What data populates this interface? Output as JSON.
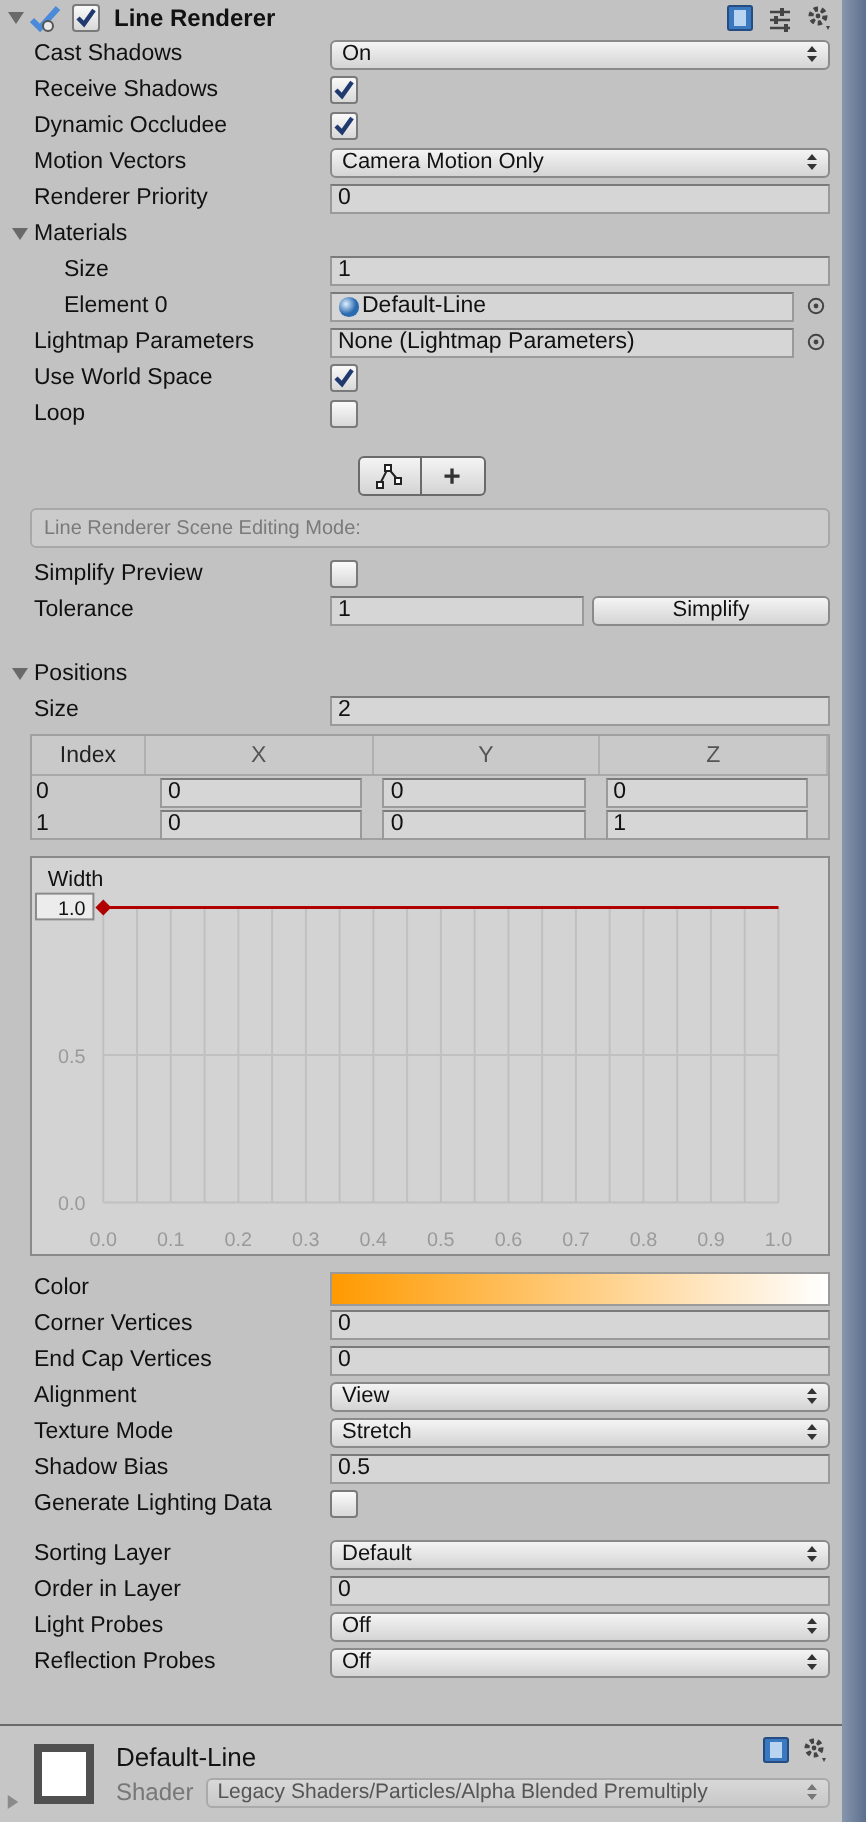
{
  "component": {
    "title": "Line Renderer",
    "enabled": true,
    "expanded": true
  },
  "properties": [
    {
      "kind": "dropdown",
      "label": "Cast Shadows",
      "value": "On"
    },
    {
      "kind": "checkbox",
      "label": "Receive Shadows",
      "checked": true
    },
    {
      "kind": "checkbox",
      "label": "Dynamic Occludee",
      "checked": true
    },
    {
      "kind": "dropdown",
      "label": "Motion Vectors",
      "value": "Camera Motion Only"
    },
    {
      "kind": "field",
      "label": "Renderer Priority",
      "value": "0"
    },
    {
      "kind": "foldout",
      "label": "Materials",
      "expanded": true,
      "children": [
        {
          "kind": "field",
          "label": "Size",
          "value": "1"
        },
        {
          "kind": "material",
          "label": "Element 0",
          "value": "Default-Line"
        }
      ]
    },
    {
      "kind": "object",
      "label": "Lightmap Parameters",
      "value": "None (Lightmap Parameters)"
    },
    {
      "kind": "checkbox",
      "label": "Use World Space",
      "checked": true
    },
    {
      "kind": "checkbox",
      "label": "Loop",
      "checked": false
    }
  ],
  "edit_tools": [
    {
      "kind": "edit_points"
    },
    {
      "kind": "add_point",
      "symbol": "+"
    }
  ],
  "scene_editing_mode": "Line Renderer Scene Editing Mode:",
  "simplify": [
    {
      "kind": "checkbox",
      "label": "Simplify Preview",
      "checked": false
    },
    {
      "kind": "field_button",
      "label": "Tolerance",
      "value": "1",
      "button": "Simplify"
    }
  ],
  "positions": {
    "label": "Positions",
    "expanded": true,
    "size_label": "Size",
    "size": "2",
    "columns": [
      "Index",
      "X",
      "Y",
      "Z"
    ],
    "rows": [
      [
        "0",
        "0",
        "0",
        "0"
      ],
      [
        "1",
        "0",
        "0",
        "1"
      ]
    ]
  },
  "width_curve": {
    "chart_data": {
      "type": "line",
      "title": "Width",
      "x": [
        0,
        1
      ],
      "grid": true,
      "series": [
        {
          "color": "#b00000",
          "values": [
            1.0,
            1.0
          ]
        }
      ],
      "xlim": [
        0,
        1
      ],
      "ylim": [
        0,
        1
      ],
      "xticks": [
        {
          "value": 0,
          "label": "0.0"
        },
        0.1,
        0.2,
        0.3,
        0.4,
        0.5,
        0.6,
        0.7,
        0.8,
        0.9,
        {
          "value": 1,
          "label": "1.0"
        }
      ],
      "yticks": [
        {
          "value": 0,
          "label": "0.0"
        },
        0.5,
        {
          "value": 1,
          "label": "1.0"
        }
      ]
    }
  },
  "properties_2": [
    {
      "kind": "gradient",
      "label": "Color",
      "stops": [
        {
          "color": "#ff9a00"
        },
        {
          "color": "#ffffff"
        }
      ]
    },
    {
      "kind": "field",
      "label": "Corner Vertices",
      "value": "0"
    },
    {
      "kind": "field",
      "label": "End Cap Vertices",
      "value": "0"
    },
    {
      "kind": "dropdown",
      "label": "Alignment",
      "value": "View"
    },
    {
      "kind": "dropdown",
      "label": "Texture Mode",
      "value": "Stretch"
    },
    {
      "kind": "field",
      "label": "Shadow Bias",
      "value": "0.5"
    },
    {
      "kind": "checkbox",
      "label": "Generate Lighting Data",
      "checked": false
    }
  ],
  "sorting": [
    {
      "kind": "dropdown",
      "label": "Sorting Layer",
      "value": "Default"
    },
    {
      "kind": "field",
      "label": "Order in Layer",
      "value": "0"
    },
    {
      "kind": "dropdown",
      "label": "Light Probes",
      "value": "Off"
    },
    {
      "kind": "dropdown",
      "label": "Reflection Probes",
      "value": "Off"
    }
  ],
  "material": {
    "name": "Default-Line",
    "shader_label": "Shader",
    "shader": "Legacy Shaders/Particles/Alpha Blended Premultiply",
    "expanded": false
  }
}
